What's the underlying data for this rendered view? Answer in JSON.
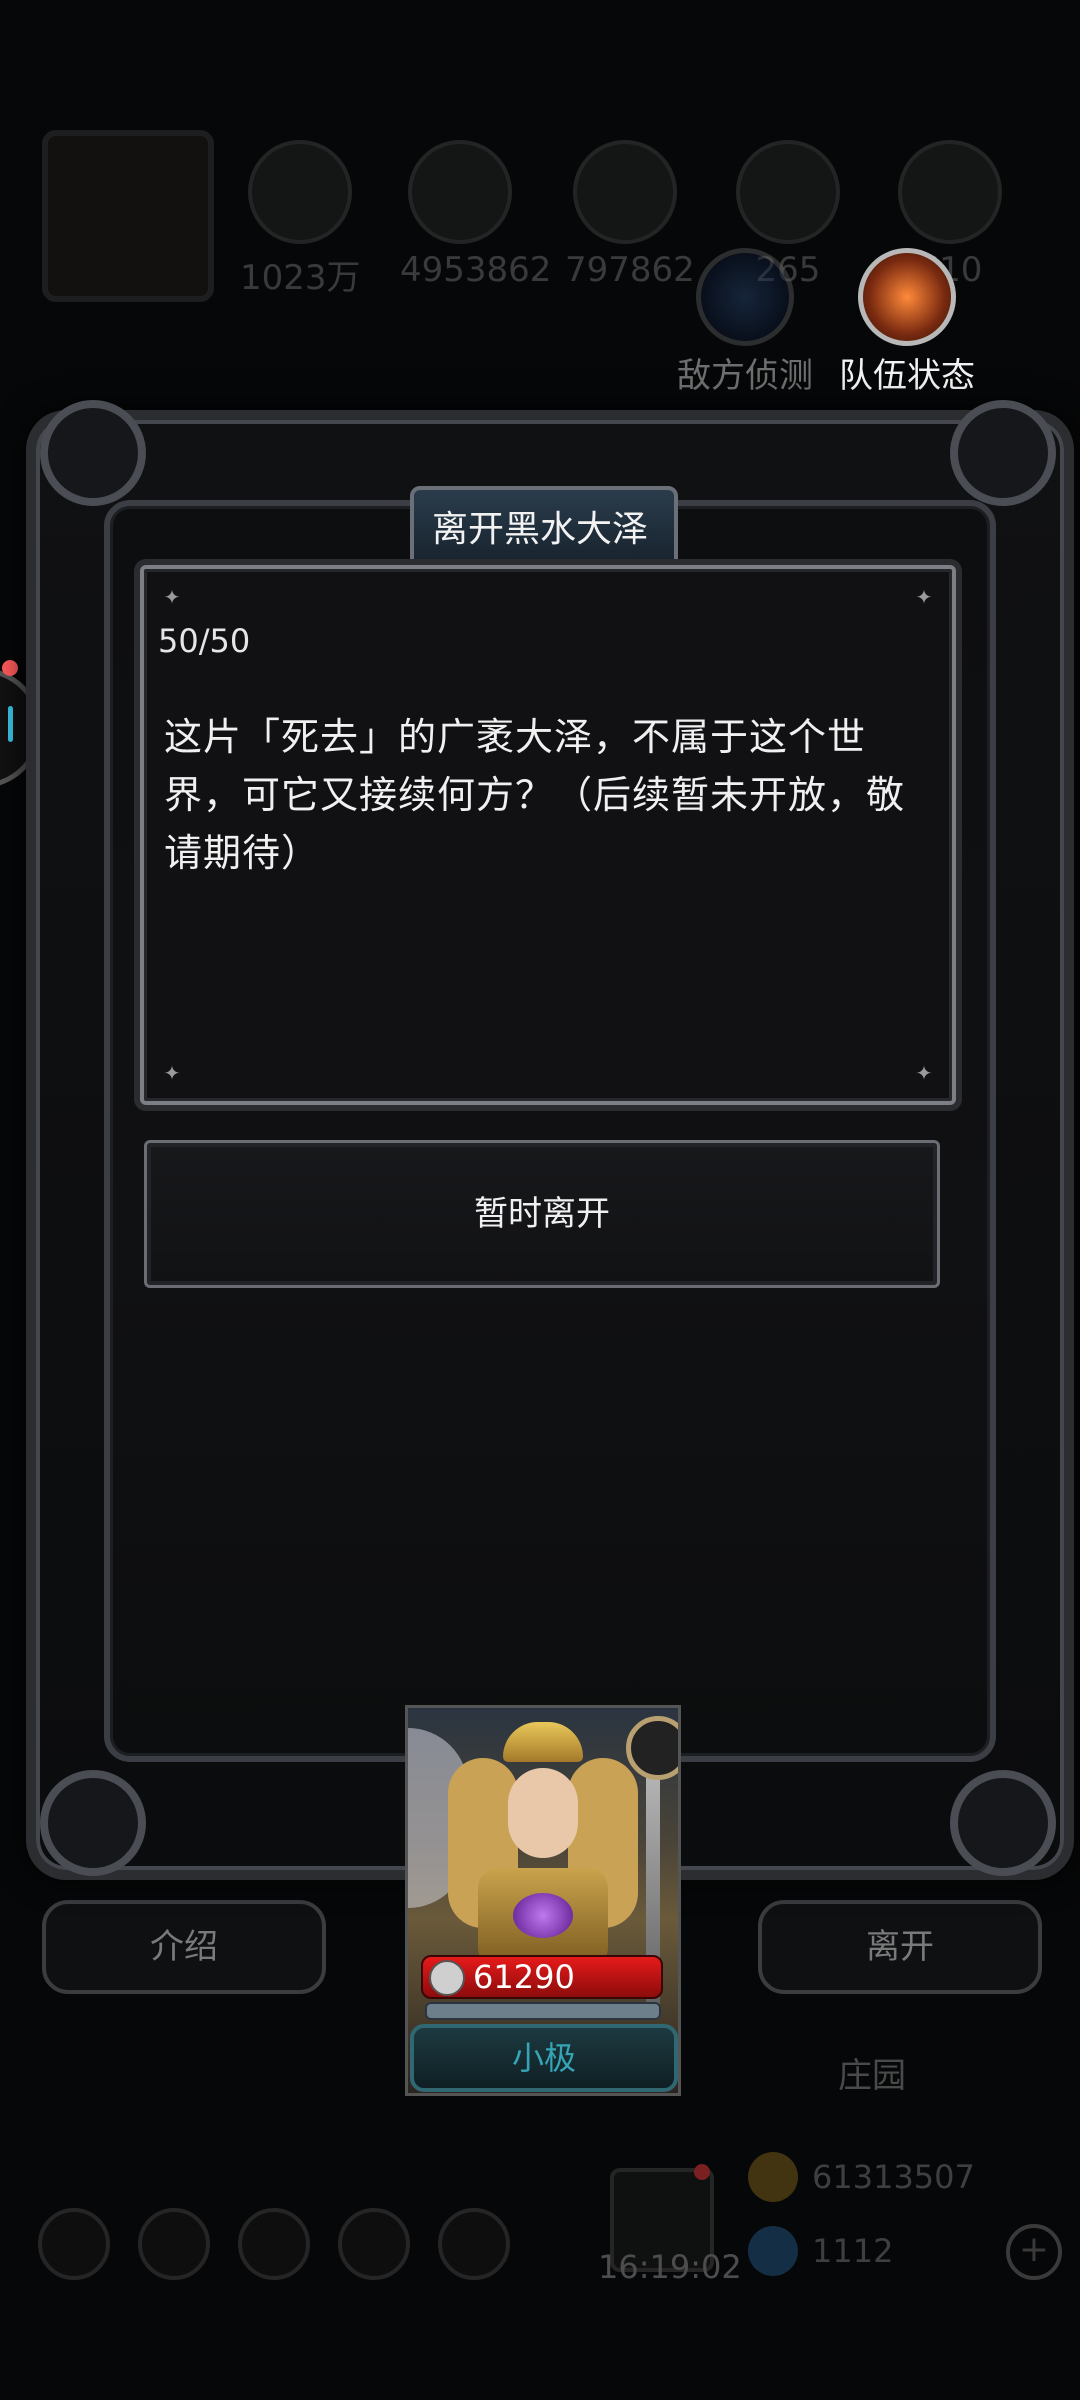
{
  "top_resources": [
    {
      "icon": "meat-icon",
      "value": "1023万"
    },
    {
      "icon": "wood-icon",
      "value": "4953862"
    },
    {
      "icon": "stone-icon",
      "value": "797862"
    },
    {
      "icon": "water-icon",
      "value": "265"
    },
    {
      "icon": "iron-icon",
      "value": "710"
    }
  ],
  "actions": {
    "scan_label": "敌方侦测",
    "team_label": "队伍状态"
  },
  "modal": {
    "title": "离开黑水大泽",
    "counter": "50/50",
    "story": "这片「死去」的广袤大泽，不属于这个世界，可它又接续何方？（后续暂未开放，敬请期待）",
    "option_label": "暂时离开"
  },
  "nav": {
    "intro_label": "介绍",
    "leave_label": "离开",
    "manor_label": "庄园"
  },
  "hero": {
    "power": "61290",
    "name": "小极"
  },
  "bottom": {
    "time": "16:19:02",
    "coins": "61313507",
    "gems": "1112"
  },
  "colors": {
    "power_bar": "#e61a1a",
    "name_text": "#35a5b5",
    "edge_badge": "#ff5b5b"
  }
}
